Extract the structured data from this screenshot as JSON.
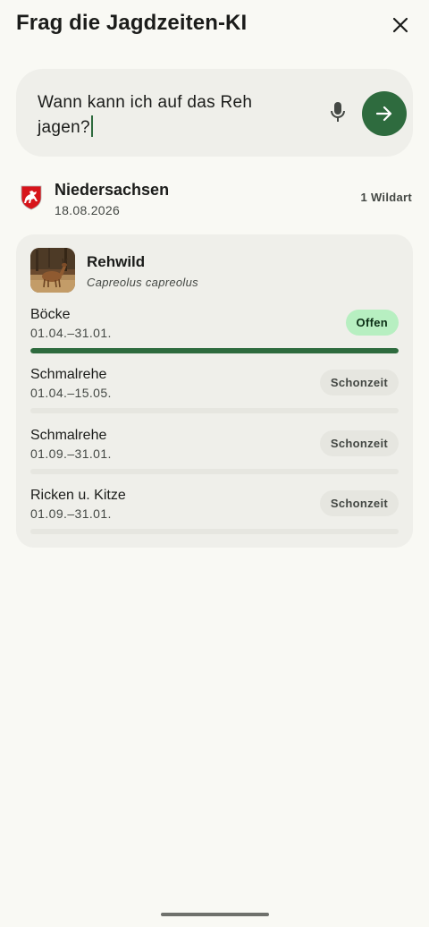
{
  "header": {
    "title": "Frag die Jagdzeiten-KI",
    "close_icon": "close-icon"
  },
  "search": {
    "query_line1": "Wann kann ich auf das Reh",
    "query_line2": "jagen?",
    "mic_icon": "microphone-icon",
    "send_icon": "arrow-right-icon"
  },
  "region": {
    "name": "Niedersachsen",
    "date": "18.08.2026",
    "count": "1 Wildart",
    "crest_icon": "niedersachsen-crest-icon"
  },
  "species": {
    "name": "Rehwild",
    "latin": "Capreolus capreolus",
    "seasons": [
      {
        "name": "Böcke",
        "range": "01.04.–31.01.",
        "status": "Offen",
        "open": true,
        "progress": 1.0
      },
      {
        "name": "Schmalrehe",
        "range": "01.04.–15.05.",
        "status": "Schonzeit",
        "open": false,
        "progress": 0.0
      },
      {
        "name": "Schmalrehe",
        "range": "01.09.–31.01.",
        "status": "Schonzeit",
        "open": false,
        "progress": 0.0
      },
      {
        "name": "Ricken u. Kitze",
        "range": "01.09.–31.01.",
        "status": "Schonzeit",
        "open": false,
        "progress": 0.0
      }
    ]
  },
  "colors": {
    "accent": "#2e6b3e",
    "open_badge": "#b7efc1",
    "closed_badge": "#e6e6e0",
    "background": "#f9f9f4",
    "card": "#efefea"
  }
}
